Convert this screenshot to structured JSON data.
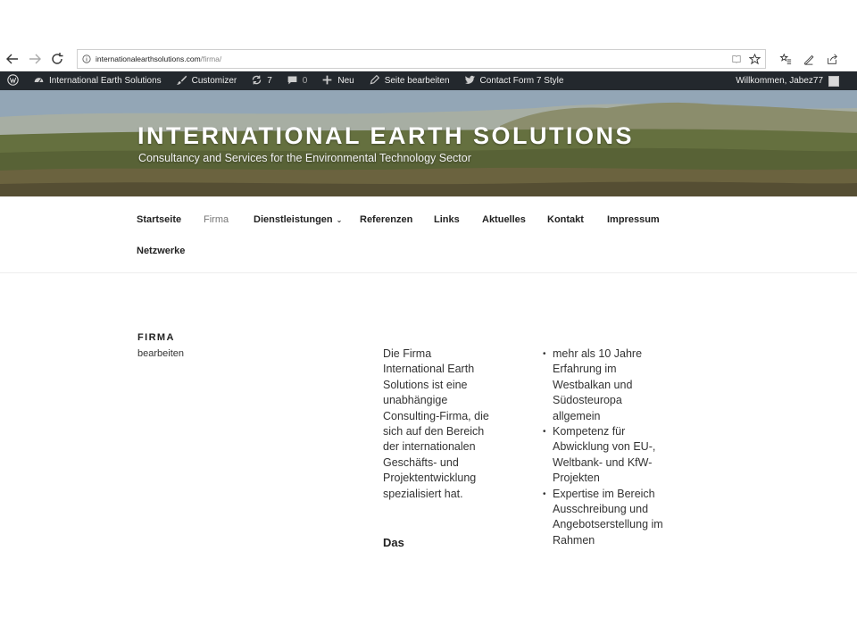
{
  "browser": {
    "url_domain": "internationalearthsolutions.com",
    "url_path": "/firma/"
  },
  "adminbar": {
    "site_name": "International Earth Solutions",
    "customizer": "Customizer",
    "updates_count": "7",
    "comments_count": "0",
    "new_label": "Neu",
    "edit_page": "Seite bearbeiten",
    "contact_form": "Contact Form 7 Style",
    "welcome": "Willkommen, Jabez77"
  },
  "header": {
    "title": "INTERNATIONAL EARTH SOLUTIONS",
    "description": "Consultancy and Services for the Environmental Technology Sector"
  },
  "nav": {
    "items": [
      {
        "label": "Startseite"
      },
      {
        "label": "Firma"
      },
      {
        "label": "Dienstleistungen"
      },
      {
        "label": "Referenzen"
      },
      {
        "label": "Links"
      },
      {
        "label": "Aktuelles"
      },
      {
        "label": "Kontakt"
      },
      {
        "label": "Impressum"
      },
      {
        "label": "Netzwerke"
      }
    ]
  },
  "content": {
    "title": "FIRMA",
    "edit": "bearbeiten",
    "column1_text": "Die Firma International Earth Solutions ist eine unabhängige Consulting-Firma, die sich auf den Bereich der internationalen Geschäfts- und Projektentwicklung spezialisiert hat.",
    "column1_heading": "Das",
    "bullets": [
      "mehr als 10 Jahre Erfahrung im Westbalkan und Südosteuropa allgemein",
      "Kompetenz für Abwicklung von EU-, Weltbank- und KfW-Projekten",
      "Expertise im Bereich Ausschreibung und Angebotserstellung im Rahmen"
    ]
  }
}
